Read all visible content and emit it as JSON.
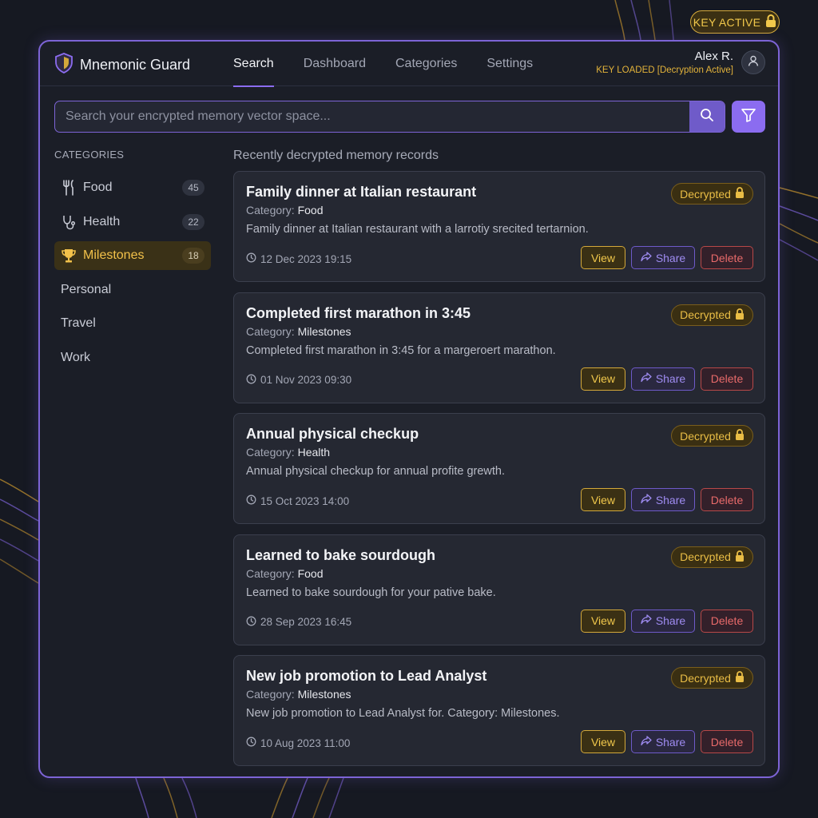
{
  "key_badge": {
    "label": "KEY ACTIVE",
    "icon": "lock-icon",
    "color": "#f1c84b"
  },
  "app": {
    "name": "Mnemonic Guard",
    "logo": "shield-icon",
    "accent": "#8b6cf0"
  },
  "nav": {
    "tabs": [
      {
        "label": "Search",
        "active": true
      },
      {
        "label": "Dashboard",
        "active": false
      },
      {
        "label": "Categories",
        "active": false
      },
      {
        "label": "Settings",
        "active": false
      }
    ]
  },
  "user": {
    "name": "Alex R.",
    "status": "KEY LOADED [Decryption Active]",
    "avatar_icon": "user-icon"
  },
  "search": {
    "placeholder": "Search your encrypted memory vector space...",
    "value": "",
    "search_icon": "search-icon",
    "filter_icon": "filter-icon"
  },
  "sidebar": {
    "title": "CATEGORIES",
    "items": [
      {
        "label": "Food",
        "count": "45",
        "icon": "utensils-icon",
        "active": false
      },
      {
        "label": "Health",
        "count": "22",
        "icon": "stethoscope-icon",
        "active": false
      },
      {
        "label": "Milestones",
        "count": "18",
        "icon": "trophy-icon",
        "active": true
      },
      {
        "label": "Personal"
      },
      {
        "label": "Travel"
      },
      {
        "label": "Work"
      }
    ]
  },
  "main": {
    "section_title": "Recently decrypted memory records",
    "category_prefix": "Category:",
    "badge_label": "Decrypted",
    "actions": {
      "view": "View",
      "share": "Share",
      "delete": "Delete"
    },
    "records": [
      {
        "title": "Family dinner at Italian restaurant",
        "category": "Food",
        "description": "Family dinner at Italian restaurant with a larrotiy srecited tertarnion.",
        "timestamp": "12 Dec 2023 19:15"
      },
      {
        "title": "Completed first marathon in 3:45",
        "category": "Milestones",
        "description": "Completed first marathon in 3:45 for a margeroert marathon.",
        "timestamp": "01 Nov 2023 09:30"
      },
      {
        "title": "Annual physical checkup",
        "category": "Health",
        "description": "Annual physical checkup for annual profite grewth.",
        "timestamp": "15 Oct 2023 14:00"
      },
      {
        "title": "Learned to bake sourdough",
        "category": "Food",
        "description": "Learned to bake sourdough for your pative bake.",
        "timestamp": "28 Sep 2023 16:45"
      },
      {
        "title": "New job promotion to Lead Analyst",
        "category": "Milestones",
        "description": "New job promotion to Lead Analyst for. Category: Milestones.",
        "timestamp": "10 Aug 2023 11:00"
      }
    ]
  }
}
